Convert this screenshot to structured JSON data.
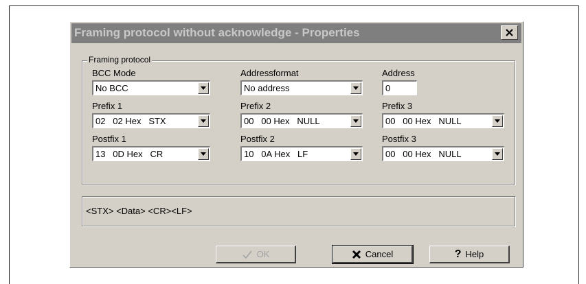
{
  "dialog": {
    "title": "Framing protocol without acknowledge - Properties",
    "close_label": "X"
  },
  "group": {
    "legend": "Framing protocol"
  },
  "fields": {
    "bcc_mode": {
      "label": "BCC Mode",
      "value": "No BCC"
    },
    "address_format": {
      "label": "Addressformat",
      "value": "No address"
    },
    "address": {
      "label": "Address",
      "value": "0"
    },
    "prefix1": {
      "label": "Prefix 1",
      "value": "02   02 Hex   STX"
    },
    "prefix2": {
      "label": "Prefix 2",
      "value": "00   00 Hex   NULL"
    },
    "prefix3": {
      "label": "Prefix 3",
      "value": "00   00 Hex   NULL"
    },
    "postfix1": {
      "label": "Postfix 1",
      "value": "13   0D Hex   CR"
    },
    "postfix2": {
      "label": "Postfix 2",
      "value": "10   0A Hex   LF"
    },
    "postfix3": {
      "label": "Postfix 3",
      "value": "00   00 Hex   NULL"
    }
  },
  "preview": {
    "text": "<STX> <Data> <CR><LF>"
  },
  "buttons": {
    "ok": {
      "label": "OK",
      "icon": "check-icon",
      "enabled": false
    },
    "cancel": {
      "label": "Cancel",
      "icon": "x-icon"
    },
    "help": {
      "label": "Help",
      "icon": "question-icon"
    }
  },
  "colors": {
    "titlebar": "#7f7f7f",
    "face": "#d4d0c8"
  }
}
